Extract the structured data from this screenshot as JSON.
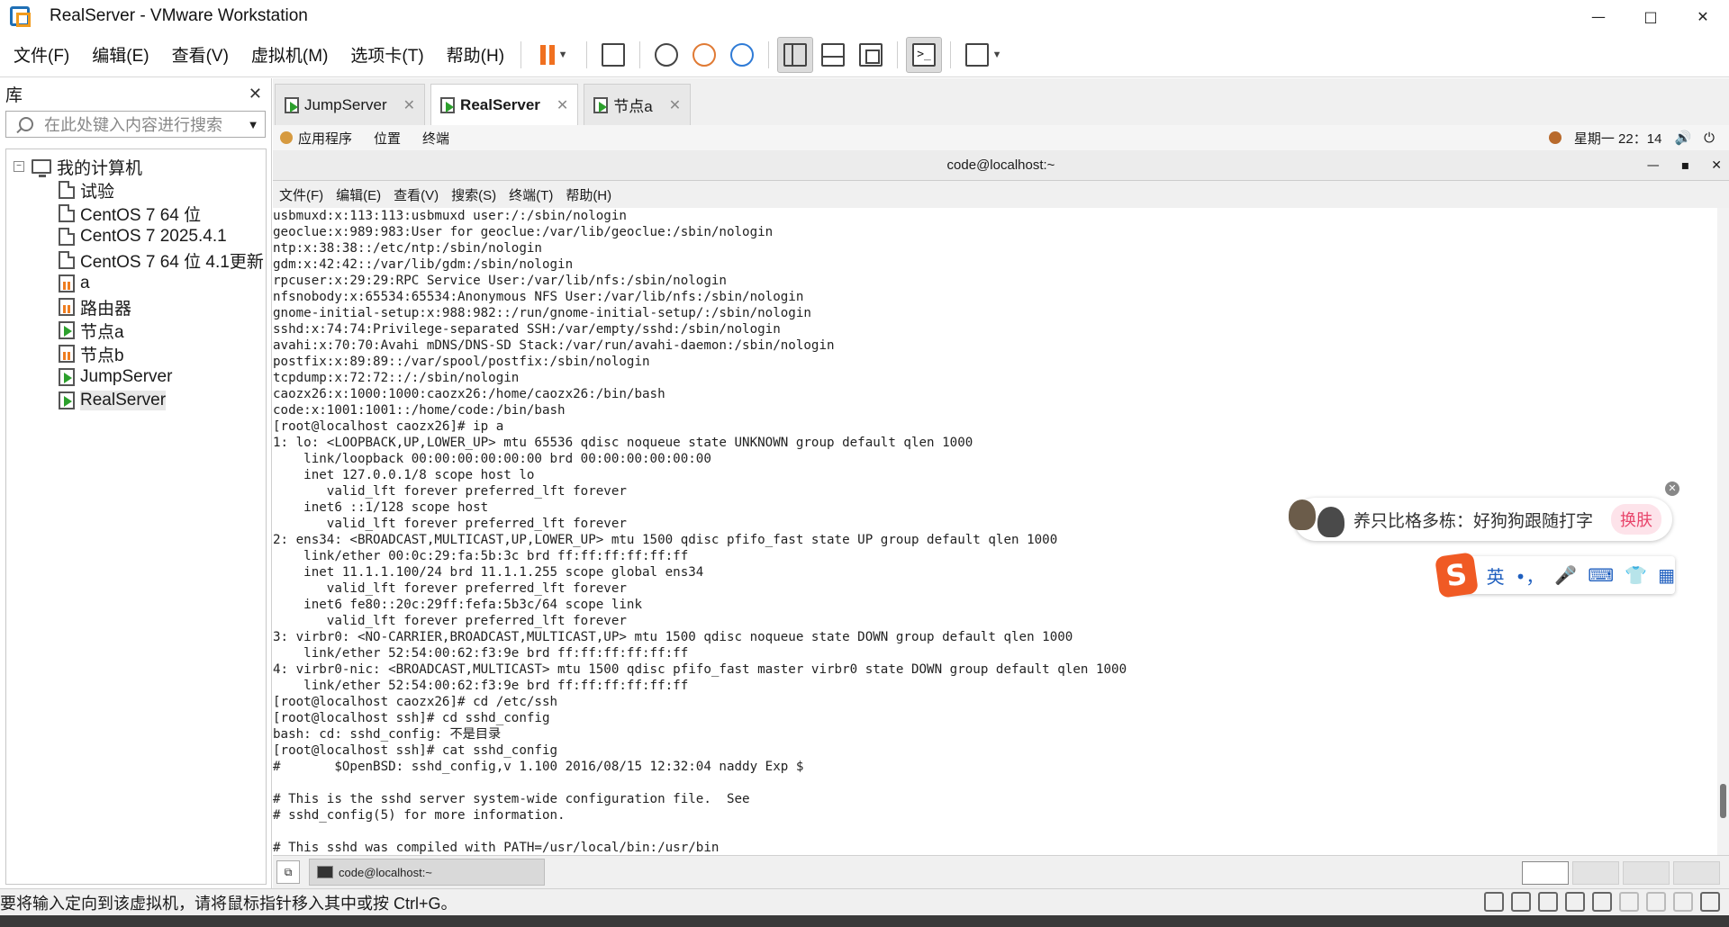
{
  "window": {
    "title": "RealServer - VMware Workstation",
    "controls": [
      "—",
      "□",
      "✕"
    ]
  },
  "menu": [
    "文件(F)",
    "编辑(E)",
    "查看(V)",
    "虚拟机(M)",
    "选项卡(T)",
    "帮助(H)"
  ],
  "library": {
    "title": "库",
    "close": "✕",
    "search_placeholder": "在此处键入内容进行搜索",
    "root": "我的计算机",
    "items": [
      {
        "label": "试验",
        "state": "plain"
      },
      {
        "label": "CentOS 7 64 位",
        "state": "plain"
      },
      {
        "label": "CentOS 7 2025.4.1",
        "state": "plain"
      },
      {
        "label": "CentOS 7 64 位 4.1更新",
        "state": "plain"
      },
      {
        "label": "a",
        "state": "off"
      },
      {
        "label": "路由器",
        "state": "off"
      },
      {
        "label": "节点a",
        "state": "on"
      },
      {
        "label": "节点b",
        "state": "off"
      },
      {
        "label": "JumpServer",
        "state": "on"
      },
      {
        "label": "RealServer",
        "state": "on"
      }
    ]
  },
  "tabs": [
    {
      "label": "JumpServer",
      "active": false
    },
    {
      "label": "RealServer",
      "active": true
    },
    {
      "label": "节点a",
      "active": false
    }
  ],
  "gnome": {
    "applications": "应用程序",
    "places": "位置",
    "terminal": "终端",
    "clock": "星期一 22：14"
  },
  "terminal": {
    "title": "code@localhost:~",
    "menu": [
      "文件(F)",
      "编辑(E)",
      "查看(V)",
      "搜索(S)",
      "终端(T)",
      "帮助(H)"
    ],
    "lines": [
      "usbmuxd:x:113:113:usbmuxd user:/:/sbin/nologin",
      "geoclue:x:989:983:User for geoclue:/var/lib/geoclue:/sbin/nologin",
      "ntp:x:38:38::/etc/ntp:/sbin/nologin",
      "gdm:x:42:42::/var/lib/gdm:/sbin/nologin",
      "rpcuser:x:29:29:RPC Service User:/var/lib/nfs:/sbin/nologin",
      "nfsnobody:x:65534:65534:Anonymous NFS User:/var/lib/nfs:/sbin/nologin",
      "gnome-initial-setup:x:988:982::/run/gnome-initial-setup/:/sbin/nologin",
      "sshd:x:74:74:Privilege-separated SSH:/var/empty/sshd:/sbin/nologin",
      "avahi:x:70:70:Avahi mDNS/DNS-SD Stack:/var/run/avahi-daemon:/sbin/nologin",
      "postfix:x:89:89::/var/spool/postfix:/sbin/nologin",
      "tcpdump:x:72:72::/:/sbin/nologin",
      "caozx26:x:1000:1000:caozx26:/home/caozx26:/bin/bash",
      "code:x:1001:1001::/home/code:/bin/bash",
      "[root@localhost caozx26]# ip a",
      "1: lo: <LOOPBACK,UP,LOWER_UP> mtu 65536 qdisc noqueue state UNKNOWN group default qlen 1000",
      "    link/loopback 00:00:00:00:00:00 brd 00:00:00:00:00:00",
      "    inet 127.0.0.1/8 scope host lo",
      "       valid_lft forever preferred_lft forever",
      "    inet6 ::1/128 scope host",
      "       valid_lft forever preferred_lft forever",
      "2: ens34: <BROADCAST,MULTICAST,UP,LOWER_UP> mtu 1500 qdisc pfifo_fast state UP group default qlen 1000",
      "    link/ether 00:0c:29:fa:5b:3c brd ff:ff:ff:ff:ff:ff",
      "    inet 11.1.1.100/24 brd 11.1.1.255 scope global ens34",
      "       valid_lft forever preferred_lft forever",
      "    inet6 fe80::20c:29ff:fefa:5b3c/64 scope link",
      "       valid_lft forever preferred_lft forever",
      "3: virbr0: <NO-CARRIER,BROADCAST,MULTICAST,UP> mtu 1500 qdisc noqueue state DOWN group default qlen 1000",
      "    link/ether 52:54:00:62:f3:9e brd ff:ff:ff:ff:ff:ff",
      "4: virbr0-nic: <BROADCAST,MULTICAST> mtu 1500 qdisc pfifo_fast master virbr0 state DOWN group default qlen 1000",
      "    link/ether 52:54:00:62:f3:9e brd ff:ff:ff:ff:ff:ff",
      "[root@localhost caozx26]# cd /etc/ssh",
      "[root@localhost ssh]# cd sshd_config",
      "bash: cd: sshd_config: 不是目录",
      "[root@localhost ssh]# cat sshd_config",
      "#       $OpenBSD: sshd_config,v 1.100 2016/08/15 12:32:04 naddy Exp $",
      "",
      "# This is the sshd server system-wide configuration file.  See",
      "# sshd_config(5) for more information.",
      "",
      "# This sshd was compiled with PATH=/usr/local/bin:/usr/bin"
    ]
  },
  "taskbar": {
    "window_button": "code@localhost:~"
  },
  "ime": {
    "promo": "养只比格多栋：好狗狗跟随打字",
    "swap": "换肤",
    "close": "✕",
    "logo": "S",
    "lang": "英",
    "punct": "•，",
    "options": [
      "🎤",
      "⌨",
      "👕",
      "▦"
    ]
  },
  "status": {
    "message": "要将输入定向到该虚拟机，请将鼠标指针移入其中或按 Ctrl+G。"
  }
}
